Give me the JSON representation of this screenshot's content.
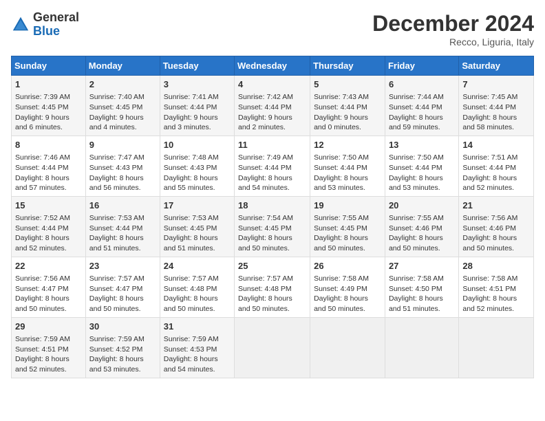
{
  "header": {
    "logo_general": "General",
    "logo_blue": "Blue",
    "title": "December 2024",
    "location": "Recco, Liguria, Italy"
  },
  "days_of_week": [
    "Sunday",
    "Monday",
    "Tuesday",
    "Wednesday",
    "Thursday",
    "Friday",
    "Saturday"
  ],
  "weeks": [
    [
      {
        "day": "1",
        "sunrise": "Sunrise: 7:39 AM",
        "sunset": "Sunset: 4:45 PM",
        "daylight": "Daylight: 9 hours and 6 minutes."
      },
      {
        "day": "2",
        "sunrise": "Sunrise: 7:40 AM",
        "sunset": "Sunset: 4:45 PM",
        "daylight": "Daylight: 9 hours and 4 minutes."
      },
      {
        "day": "3",
        "sunrise": "Sunrise: 7:41 AM",
        "sunset": "Sunset: 4:44 PM",
        "daylight": "Daylight: 9 hours and 3 minutes."
      },
      {
        "day": "4",
        "sunrise": "Sunrise: 7:42 AM",
        "sunset": "Sunset: 4:44 PM",
        "daylight": "Daylight: 9 hours and 2 minutes."
      },
      {
        "day": "5",
        "sunrise": "Sunrise: 7:43 AM",
        "sunset": "Sunset: 4:44 PM",
        "daylight": "Daylight: 9 hours and 0 minutes."
      },
      {
        "day": "6",
        "sunrise": "Sunrise: 7:44 AM",
        "sunset": "Sunset: 4:44 PM",
        "daylight": "Daylight: 8 hours and 59 minutes."
      },
      {
        "day": "7",
        "sunrise": "Sunrise: 7:45 AM",
        "sunset": "Sunset: 4:44 PM",
        "daylight": "Daylight: 8 hours and 58 minutes."
      }
    ],
    [
      {
        "day": "8",
        "sunrise": "Sunrise: 7:46 AM",
        "sunset": "Sunset: 4:44 PM",
        "daylight": "Daylight: 8 hours and 57 minutes."
      },
      {
        "day": "9",
        "sunrise": "Sunrise: 7:47 AM",
        "sunset": "Sunset: 4:43 PM",
        "daylight": "Daylight: 8 hours and 56 minutes."
      },
      {
        "day": "10",
        "sunrise": "Sunrise: 7:48 AM",
        "sunset": "Sunset: 4:43 PM",
        "daylight": "Daylight: 8 hours and 55 minutes."
      },
      {
        "day": "11",
        "sunrise": "Sunrise: 7:49 AM",
        "sunset": "Sunset: 4:44 PM",
        "daylight": "Daylight: 8 hours and 54 minutes."
      },
      {
        "day": "12",
        "sunrise": "Sunrise: 7:50 AM",
        "sunset": "Sunset: 4:44 PM",
        "daylight": "Daylight: 8 hours and 53 minutes."
      },
      {
        "day": "13",
        "sunrise": "Sunrise: 7:50 AM",
        "sunset": "Sunset: 4:44 PM",
        "daylight": "Daylight: 8 hours and 53 minutes."
      },
      {
        "day": "14",
        "sunrise": "Sunrise: 7:51 AM",
        "sunset": "Sunset: 4:44 PM",
        "daylight": "Daylight: 8 hours and 52 minutes."
      }
    ],
    [
      {
        "day": "15",
        "sunrise": "Sunrise: 7:52 AM",
        "sunset": "Sunset: 4:44 PM",
        "daylight": "Daylight: 8 hours and 52 minutes."
      },
      {
        "day": "16",
        "sunrise": "Sunrise: 7:53 AM",
        "sunset": "Sunset: 4:44 PM",
        "daylight": "Daylight: 8 hours and 51 minutes."
      },
      {
        "day": "17",
        "sunrise": "Sunrise: 7:53 AM",
        "sunset": "Sunset: 4:45 PM",
        "daylight": "Daylight: 8 hours and 51 minutes."
      },
      {
        "day": "18",
        "sunrise": "Sunrise: 7:54 AM",
        "sunset": "Sunset: 4:45 PM",
        "daylight": "Daylight: 8 hours and 50 minutes."
      },
      {
        "day": "19",
        "sunrise": "Sunrise: 7:55 AM",
        "sunset": "Sunset: 4:45 PM",
        "daylight": "Daylight: 8 hours and 50 minutes."
      },
      {
        "day": "20",
        "sunrise": "Sunrise: 7:55 AM",
        "sunset": "Sunset: 4:46 PM",
        "daylight": "Daylight: 8 hours and 50 minutes."
      },
      {
        "day": "21",
        "sunrise": "Sunrise: 7:56 AM",
        "sunset": "Sunset: 4:46 PM",
        "daylight": "Daylight: 8 hours and 50 minutes."
      }
    ],
    [
      {
        "day": "22",
        "sunrise": "Sunrise: 7:56 AM",
        "sunset": "Sunset: 4:47 PM",
        "daylight": "Daylight: 8 hours and 50 minutes."
      },
      {
        "day": "23",
        "sunrise": "Sunrise: 7:57 AM",
        "sunset": "Sunset: 4:47 PM",
        "daylight": "Daylight: 8 hours and 50 minutes."
      },
      {
        "day": "24",
        "sunrise": "Sunrise: 7:57 AM",
        "sunset": "Sunset: 4:48 PM",
        "daylight": "Daylight: 8 hours and 50 minutes."
      },
      {
        "day": "25",
        "sunrise": "Sunrise: 7:57 AM",
        "sunset": "Sunset: 4:48 PM",
        "daylight": "Daylight: 8 hours and 50 minutes."
      },
      {
        "day": "26",
        "sunrise": "Sunrise: 7:58 AM",
        "sunset": "Sunset: 4:49 PM",
        "daylight": "Daylight: 8 hours and 50 minutes."
      },
      {
        "day": "27",
        "sunrise": "Sunrise: 7:58 AM",
        "sunset": "Sunset: 4:50 PM",
        "daylight": "Daylight: 8 hours and 51 minutes."
      },
      {
        "day": "28",
        "sunrise": "Sunrise: 7:58 AM",
        "sunset": "Sunset: 4:51 PM",
        "daylight": "Daylight: 8 hours and 52 minutes."
      }
    ],
    [
      {
        "day": "29",
        "sunrise": "Sunrise: 7:59 AM",
        "sunset": "Sunset: 4:51 PM",
        "daylight": "Daylight: 8 hours and 52 minutes."
      },
      {
        "day": "30",
        "sunrise": "Sunrise: 7:59 AM",
        "sunset": "Sunset: 4:52 PM",
        "daylight": "Daylight: 8 hours and 53 minutes."
      },
      {
        "day": "31",
        "sunrise": "Sunrise: 7:59 AM",
        "sunset": "Sunset: 4:53 PM",
        "daylight": "Daylight: 8 hours and 54 minutes."
      },
      null,
      null,
      null,
      null
    ]
  ]
}
